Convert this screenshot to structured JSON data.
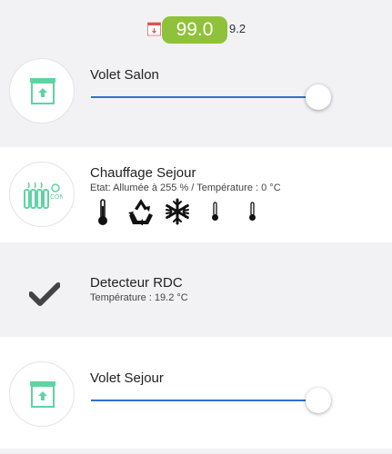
{
  "header": {
    "value": "99.0",
    "secondary": "9.2",
    "icons": [
      "calendar-icon"
    ]
  },
  "devices": [
    {
      "title": "Volet Salon",
      "icon": "shutter-icon",
      "slider_level": 1.0
    },
    {
      "title": "Chauffage Sejour",
      "status": "Etat: Allumée à 255 % / Température : 0 °C",
      "icon": "radiator-icon",
      "actions": [
        "thermometer-icon",
        "recycle-icon",
        "snowflake-icon",
        "thermometer-small-icon",
        "thermometer-small-icon"
      ]
    },
    {
      "title": "Detecteur RDC",
      "status": "Température : 19.2 °C",
      "icon": "checkmark-icon"
    },
    {
      "title": "Volet Sejour",
      "icon": "shutter-icon",
      "slider_level": 1.0
    }
  ],
  "colors": {
    "badge": "#8fc23a",
    "accent_green": "#5fd3a2",
    "slider": "#2f6fd6"
  }
}
